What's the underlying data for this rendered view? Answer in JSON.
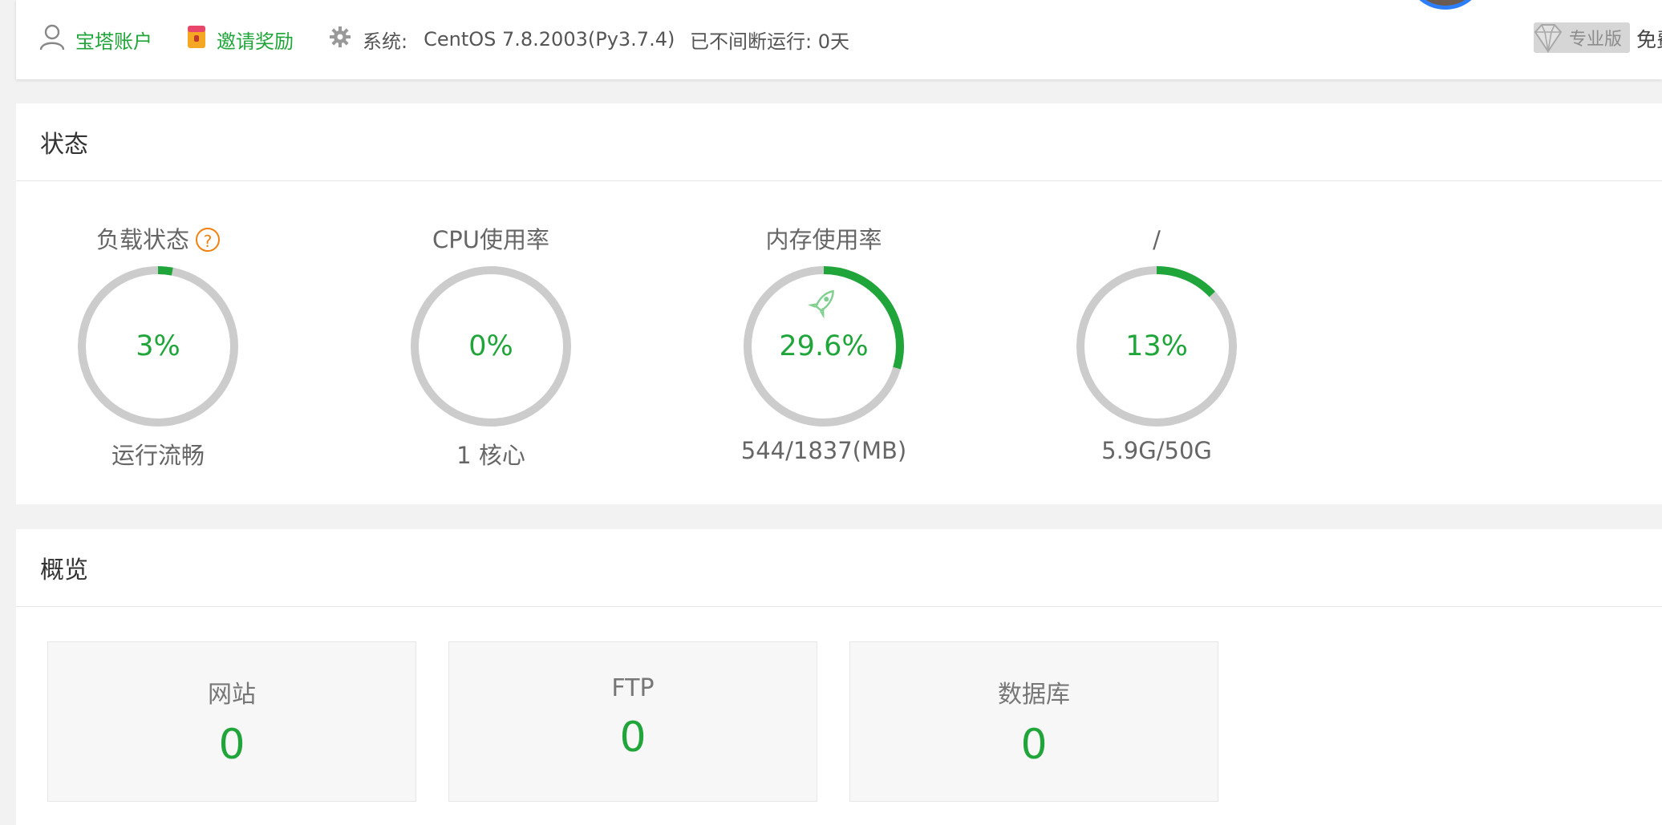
{
  "topbar": {
    "account_label": "宝塔账户",
    "invite_label": "邀请奖励",
    "system_prefix": "系统:",
    "system_value": "CentOS 7.8.2003(Py3.7.4)",
    "uptime": "已不间断运行: 0天",
    "pro_badge": "专业版",
    "free_text": "免费"
  },
  "status": {
    "title": "状态",
    "gauges": [
      {
        "label": "负载状态",
        "value": "3%",
        "fraction": 0.03,
        "sub": "运行流畅"
      },
      {
        "label": "CPU使用率",
        "value": "0%",
        "fraction": 0.0,
        "sub": "1 核心"
      },
      {
        "label": "内存使用率",
        "value": "29.6%",
        "fraction": 0.296,
        "sub": "544/1837(MB)"
      },
      {
        "label": "/",
        "value": "13%",
        "fraction": 0.13,
        "sub": "5.9G/50G"
      }
    ]
  },
  "overview": {
    "title": "概览",
    "cards": [
      {
        "label": "网站",
        "value": "0"
      },
      {
        "label": "FTP",
        "value": "0"
      },
      {
        "label": "数据库",
        "value": "0"
      }
    ]
  },
  "colors": {
    "accent": "#20a53a",
    "track": "#cccccc",
    "help": "#f0810f"
  }
}
